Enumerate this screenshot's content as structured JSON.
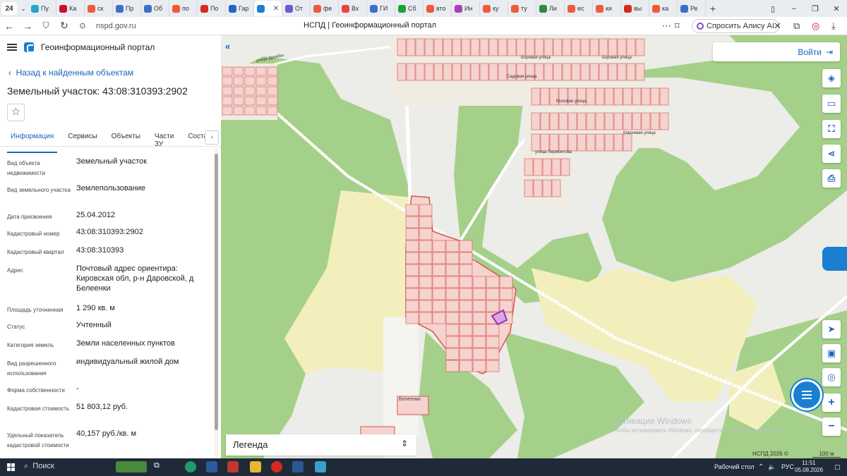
{
  "browser": {
    "tab_count_badge": "24",
    "tabs": [
      {
        "label": "Пу",
        "color": "#2aa3c7"
      },
      {
        "label": "Ка",
        "color": "#c8102e"
      },
      {
        "label": "ск",
        "color": "#f05a3c"
      },
      {
        "label": "Пр",
        "color": "#3c70c8"
      },
      {
        "label": "Об",
        "color": "#3c70c8"
      },
      {
        "label": "по",
        "color": "#f05a3c"
      },
      {
        "label": "По",
        "color": "#d52b1e"
      },
      {
        "label": "Гар",
        "color": "#2464c8"
      },
      {
        "label": "",
        "color": "#1a7fd1",
        "active": true
      },
      {
        "label": "От",
        "color": "#6b5acd"
      },
      {
        "label": "фе",
        "color": "#f05a3c"
      },
      {
        "label": "Вх",
        "color": "#e8473b"
      },
      {
        "label": "ГИ",
        "color": "#3c70c8"
      },
      {
        "label": "Сб",
        "color": "#21a038"
      },
      {
        "label": "вто",
        "color": "#f05a3c"
      },
      {
        "label": "Ин",
        "color": "#a640b7"
      },
      {
        "label": "ку",
        "color": "#f05a3c"
      },
      {
        "label": "ту",
        "color": "#f05a3c"
      },
      {
        "label": "Ли",
        "color": "#2c8b3f"
      },
      {
        "label": "ес",
        "color": "#f05a3c"
      },
      {
        "label": "ки",
        "color": "#f05a3c"
      },
      {
        "label": "вы",
        "color": "#d52b1e"
      },
      {
        "label": "ка",
        "color": "#f05a3c"
      },
      {
        "label": "Ре",
        "color": "#3c70c8"
      }
    ],
    "url": "nspd.gov.ru",
    "page_title": "НСПД | Геоинформационный портал",
    "alice_label": "Спросить Алису AI"
  },
  "panel": {
    "app_title": "Геоинформационный портал",
    "back_link": "Назад к найденным объектам",
    "object_title": "Земельный участок: 43:08:310393:2902",
    "tabs": [
      "Информация",
      "Сервисы",
      "Объекты",
      "Части ЗУ",
      "Состав"
    ],
    "active_tab": "Информация",
    "fields": [
      {
        "label": "Вид объекта недвижимости",
        "value": "Земельный участок"
      },
      {
        "label": "Вид земельного участка",
        "value": "Землепользование"
      },
      {
        "label": "Дата присвоения",
        "value": "25.04.2012"
      },
      {
        "label": "Кадастровый номер",
        "value": "43:08:310393:2902"
      },
      {
        "label": "Кадастровый квартал",
        "value": "43:08:310393"
      },
      {
        "label": "Адрес",
        "value": "Почтовый адрес ориентира: Кировская обл, р-н Даровской, д Белеенки"
      },
      {
        "label": "Площадь уточненная",
        "value": "1 290 кв. м"
      },
      {
        "label": "Статус",
        "value": "Учтенный"
      },
      {
        "label": "Категория земель",
        "value": "Земли населенных пунктов"
      },
      {
        "label": "Вид разрешенного использования",
        "value": "индивидуальный жилой дом"
      },
      {
        "label": "Форма собственности",
        "value": "-"
      },
      {
        "label": "Кадастровая стоимость",
        "value": "51 803,12 руб."
      },
      {
        "label": "Удельный показатель кадастровой стоимости",
        "value": "40,157 руб./кв. м"
      }
    ]
  },
  "map": {
    "login_label": "Войти",
    "legend_label": "Легенда",
    "streets": [
      "улица Дружбы",
      "Боровая улица",
      "Садовая улица",
      "Моховая улица",
      "Ключевая улица",
      "улица Лермонтова"
    ],
    "village_label": "Белеенки",
    "copyright": "НСПД 2026 ©",
    "scale_label": "100 м",
    "watermark_title": "Активация Windows",
    "watermark_text": "Чтобы активировать Windows, перейдите в раздел \"Параметры\".",
    "colors": {
      "forest": "#a5d08a",
      "field": "#f3efbd",
      "parcel_fill": "#f5d3cf",
      "parcel_stroke": "#d9534f",
      "selected": "#9b30b5"
    }
  },
  "taskbar": {
    "search_label": "Поиск",
    "desktop_label": "Рабочий стол",
    "language": "РУС",
    "time": "11:51",
    "date": "05.08.2026"
  }
}
